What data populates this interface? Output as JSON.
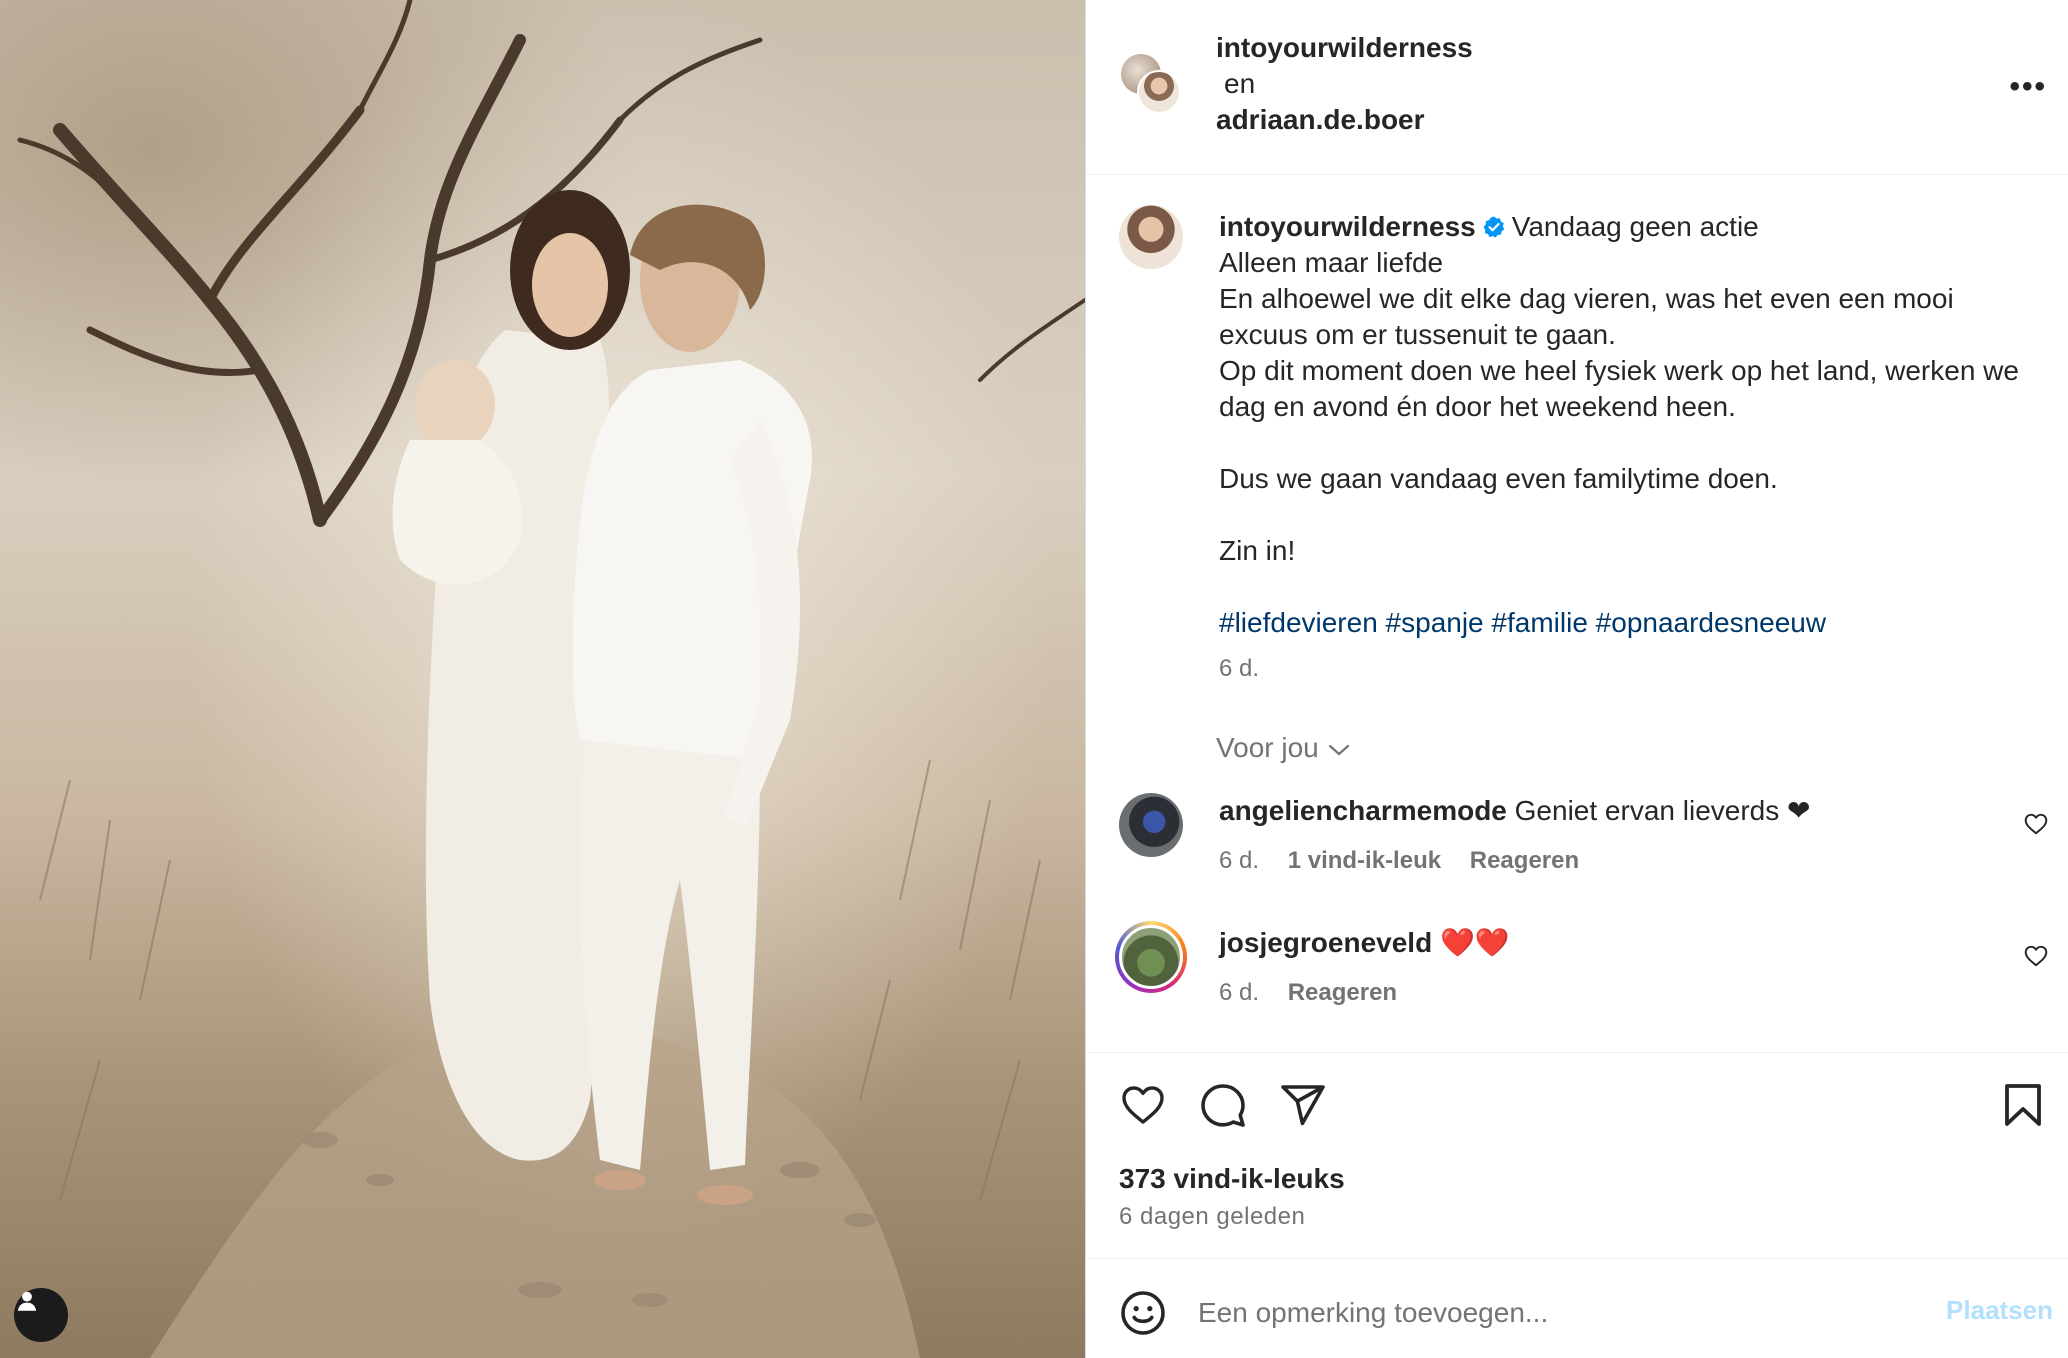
{
  "header": {
    "collaborator_1": "intoyourwilderness",
    "conjunction": "en",
    "collaborator_2": "adriaan.de.boer",
    "more_label": "•••"
  },
  "caption": {
    "username": "intoyourwilderness",
    "verified": true,
    "lines": [
      "Vandaag geen actie",
      "Alleen maar liefde",
      "En alhoewel we dit elke dag vieren, was het even een mooi excuus om er tussenuit te gaan.",
      "Op dit moment doen we heel fysiek werk op het land, werken we dag en avond én door het weekend heen.",
      "Dus we gaan vandaag even familytime doen.",
      "Zin in!",
      "#liefdevieren #spanje #familie #opnaardesneeuw"
    ],
    "timestamp": "6 d."
  },
  "for_you": {
    "label": "Voor jou"
  },
  "comments": [
    {
      "username": "angeliencharmemode",
      "text": "Geniet ervan lieverds ❤",
      "age": "6 d.",
      "likes": "1 vind-ik-leuk",
      "reply": "Reageren"
    },
    {
      "username": "josjegroeneveld",
      "text": "❤️❤️",
      "age": "6 d.",
      "reply": "Reageren"
    }
  ],
  "actions": {
    "likes_count": "373 vind-ik-leuks",
    "posted_ago": "6 dagen geleden"
  },
  "composer": {
    "placeholder": "Een opmerking toevoegen...",
    "post_label": "Plaatsen"
  },
  "icons": {
    "like": "heart-icon",
    "comment": "comment-bubble-icon",
    "share": "paper-plane-icon",
    "save": "bookmark-icon",
    "emoji": "smiley-icon",
    "tag": "user-tag-icon",
    "verified": "verified-badge-icon"
  },
  "colors": {
    "verified_blue": "#0095f6",
    "hashtag_blue": "#00376b",
    "muted_gray": "#737373",
    "post_button_disabled": "#b2dffc"
  }
}
